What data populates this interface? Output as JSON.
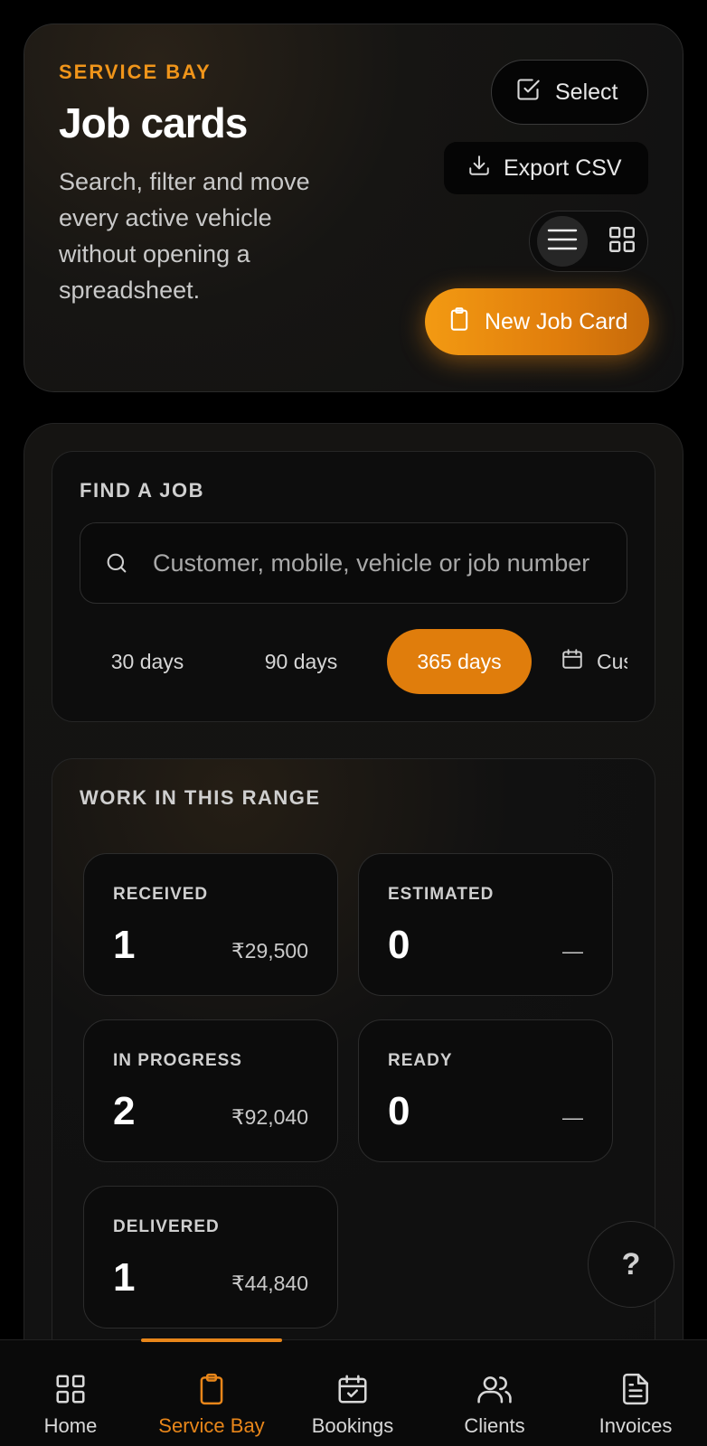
{
  "header": {
    "eyebrow": "SERVICE BAY",
    "title": "Job cards",
    "subtitle": "Search, filter and move every active vehicle without opening a spreadsheet.",
    "select_label": "Select",
    "export_label": "Export CSV",
    "new_job_label": "New Job Card"
  },
  "find": {
    "label": "FIND A JOB",
    "search_placeholder": "Customer, mobile, vehicle or job number",
    "ranges": [
      "30 days",
      "90 days",
      "365 days"
    ],
    "active_range": "365 days",
    "custom_label": "Custom"
  },
  "work": {
    "label": "WORK IN THIS RANGE",
    "stats": [
      {
        "label": "RECEIVED",
        "count": "1",
        "amount": "₹29,500"
      },
      {
        "label": "ESTIMATED",
        "count": "0",
        "amount": "—"
      },
      {
        "label": "IN PROGRESS",
        "count": "2",
        "amount": "₹92,040"
      },
      {
        "label": "READY",
        "count": "0",
        "amount": "—"
      },
      {
        "label": "DELIVERED",
        "count": "1",
        "amount": "₹44,840"
      }
    ]
  },
  "help_label": "?",
  "nav": {
    "items": [
      {
        "label": "Home",
        "icon": "grid-icon"
      },
      {
        "label": "Service Bay",
        "icon": "clipboard-icon"
      },
      {
        "label": "Bookings",
        "icon": "calendar-check-icon"
      },
      {
        "label": "Clients",
        "icon": "users-icon"
      },
      {
        "label": "Invoices",
        "icon": "file-text-icon"
      }
    ],
    "active": "Service Bay"
  },
  "colors": {
    "accent": "#e8861a",
    "background": "#000000"
  }
}
